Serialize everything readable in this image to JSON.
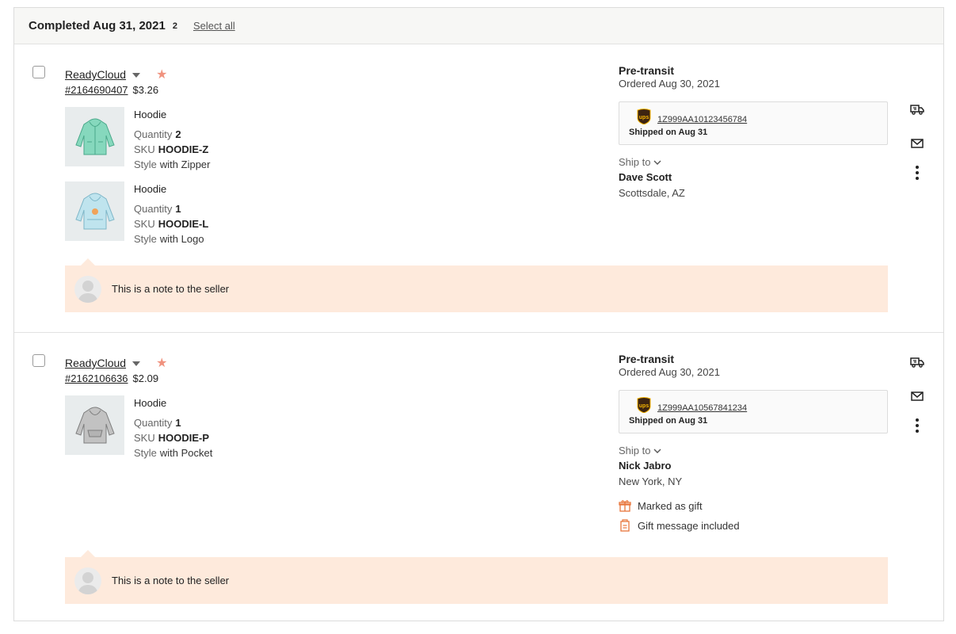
{
  "group": {
    "title": "Completed Aug 31, 2021",
    "count": "2",
    "select_all": "Select all"
  },
  "orders": [
    {
      "shop": "ReadyCloud",
      "order_number": "#2164690407",
      "price": "$3.26",
      "items": [
        {
          "title": "Hoodie",
          "quantity_label": "Quantity",
          "quantity": "2",
          "sku_label": "SKU",
          "sku": "HOODIE-Z",
          "style_label": "Style",
          "style": "with Zipper",
          "thumb_color": "#7fd3b7"
        },
        {
          "title": "Hoodie",
          "quantity_label": "Quantity",
          "quantity": "1",
          "sku_label": "SKU",
          "sku": "HOODIE-L",
          "style_label": "Style",
          "style": "with Logo",
          "thumb_color": "#a8d8e6"
        }
      ],
      "note": "This is a note to the seller",
      "status": "Pre-transit",
      "ordered": "Ordered Aug 30, 2021",
      "tracking": "1Z999AA10123456784",
      "shipped_on": "Shipped on Aug 31",
      "ship_to_label": "Ship to",
      "recipient": "Dave Scott",
      "location": "Scottsdale, AZ"
    },
    {
      "shop": "ReadyCloud",
      "order_number": "#2162106636",
      "price": "$2.09",
      "items": [
        {
          "title": "Hoodie",
          "quantity_label": "Quantity",
          "quantity": "1",
          "sku_label": "SKU",
          "sku": "HOODIE-P",
          "style_label": "Style",
          "style": "with Pocket",
          "thumb_color": "#b5b5b5"
        }
      ],
      "note": "This is a note to the seller",
      "status": "Pre-transit",
      "ordered": "Ordered Aug 30, 2021",
      "tracking": "1Z999AA10567841234",
      "shipped_on": "Shipped on Aug 31",
      "ship_to_label": "Ship to",
      "recipient": "Nick Jabro",
      "location": "New York, NY",
      "gift_marked": "Marked as gift",
      "gift_message": "Gift message included"
    }
  ],
  "colors": {
    "accent_star": "#f0927e",
    "note_background": "#feeadc",
    "gift_icon": "#e8763c",
    "ups_brown": "#3d2411",
    "ups_gold": "#f5b400"
  },
  "icons": {
    "star": "star-icon",
    "caret": "caret-down-icon",
    "ship": "truck-icon",
    "message": "envelope-icon",
    "more": "more-vertical-icon",
    "gift": "gift-icon",
    "gift_message": "gift-message-icon"
  }
}
